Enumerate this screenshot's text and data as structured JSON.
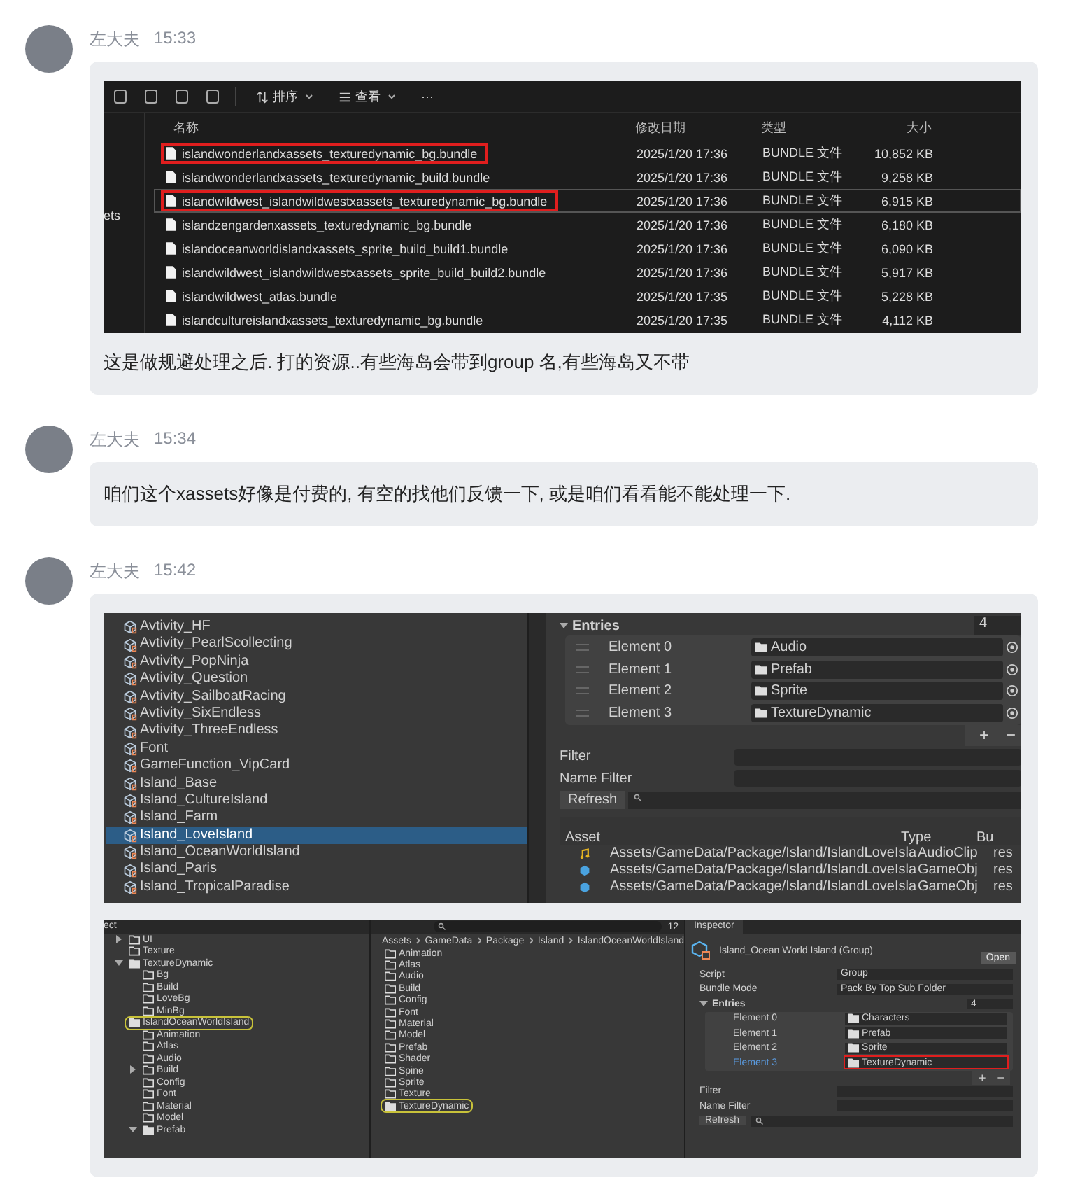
{
  "messages": [
    {
      "sender": "左大夫",
      "time": "15:33",
      "content": [
        {
          "kind": "explorer",
          "sort_label": "排序",
          "view_label": "查看",
          "more": "···",
          "nav_text": "ets",
          "columns": [
            "名称",
            "修改日期",
            "类型",
            "大小"
          ],
          "rows": [
            {
              "name": "islandwonderlandxassets_texturedynamic_bg.bundle",
              "date": "2025/1/20 17:36",
              "type": "BUNDLE 文件",
              "size": "10,852 KB",
              "marked": true,
              "selected": false
            },
            {
              "name": "islandwonderlandxassets_texturedynamic_build.bundle",
              "date": "2025/1/20 17:36",
              "type": "BUNDLE 文件",
              "size": "9,258 KB",
              "marked": false,
              "selected": false
            },
            {
              "name": "islandwildwest_islandwildwestxassets_texturedynamic_bg.bundle",
              "date": "2025/1/20 17:36",
              "type": "BUNDLE 文件",
              "size": "6,915 KB",
              "marked": true,
              "selected": true
            },
            {
              "name": "islandzengardenxassets_texturedynamic_bg.bundle",
              "date": "2025/1/20 17:36",
              "type": "BUNDLE 文件",
              "size": "6,180 KB",
              "marked": false,
              "selected": false
            },
            {
              "name": "islandoceanworldislandxassets_sprite_build_build1.bundle",
              "date": "2025/1/20 17:36",
              "type": "BUNDLE 文件",
              "size": "6,090 KB",
              "marked": false,
              "selected": false
            },
            {
              "name": "islandwildwest_islandwildwestxassets_sprite_build_build2.bundle",
              "date": "2025/1/20 17:36",
              "type": "BUNDLE 文件",
              "size": "5,917 KB",
              "marked": false,
              "selected": false
            },
            {
              "name": "islandwildwest_atlas.bundle",
              "date": "2025/1/20 17:35",
              "type": "BUNDLE 文件",
              "size": "5,228 KB",
              "marked": false,
              "selected": false
            },
            {
              "name": "islandcultureislandxassets_texturedynamic_bg.bundle",
              "date": "2025/1/20 17:35",
              "type": "BUNDLE 文件",
              "size": "4,112 KB",
              "marked": false,
              "selected": false
            }
          ]
        },
        {
          "kind": "text",
          "text": "这是做规避处理之后. 打的资源..有些海岛会带到group 名,有些海岛又不带"
        }
      ]
    },
    {
      "sender": "左大夫",
      "time": "15:34",
      "content": [
        {
          "kind": "text",
          "text": "咱们这个xassets好像是付费的, 有空的找他们反馈一下, 或是咱们看看能不能处理一下."
        }
      ]
    },
    {
      "sender": "左大夫",
      "time": "15:42",
      "content": [
        {
          "kind": "unity_groups",
          "groups": [
            {
              "label": "Avtivity_HF",
              "selected": false
            },
            {
              "label": "Avtivity_PearlScollecting",
              "selected": false
            },
            {
              "label": "Avtivity_PopNinja",
              "selected": false
            },
            {
              "label": "Avtivity_Question",
              "selected": false
            },
            {
              "label": "Avtivity_SailboatRacing",
              "selected": false
            },
            {
              "label": "Avtivity_SixEndless",
              "selected": false
            },
            {
              "label": "Avtivity_ThreeEndless",
              "selected": false
            },
            {
              "label": "Font",
              "selected": false
            },
            {
              "label": "GameFunction_VipCard",
              "selected": false
            },
            {
              "label": "Island_Base",
              "selected": false
            },
            {
              "label": "Island_CultureIsland",
              "selected": false
            },
            {
              "label": "Island_Farm",
              "selected": false
            },
            {
              "label": "Island_LoveIsland",
              "selected": true
            },
            {
              "label": "Island_OceanWorldIsland",
              "selected": false
            },
            {
              "label": "Island_Paris",
              "selected": false
            },
            {
              "label": "Island_TropicalParadise",
              "selected": false
            }
          ],
          "entries_label": "Entries",
          "entries_count": "4",
          "elements": [
            {
              "label": "Element 0",
              "value": "Audio"
            },
            {
              "label": "Element 1",
              "value": "Prefab"
            },
            {
              "label": "Element 2",
              "value": "Sprite"
            },
            {
              "label": "Element 3",
              "value": "TextureDynamic"
            }
          ],
          "add": "+",
          "remove": "−",
          "filter_label": "Filter",
          "name_filter_label": "Name Filter",
          "refresh": "Refresh",
          "columns": [
            "Asset",
            "Type",
            "Bu"
          ],
          "assets": [
            {
              "kind": "audio",
              "path": "Assets/GameData/Package/Island/IslandLoveIsla",
              "type": "AudioClip",
              "bundle": "res"
            },
            {
              "kind": "prefab",
              "path": "Assets/GameData/Package/Island/IslandLoveIsla",
              "type": "GameObj",
              "bundle": "res"
            },
            {
              "kind": "prefab",
              "path": "Assets/GameData/Package/Island/IslandLoveIsla",
              "type": "GameObj",
              "bundle": "res"
            }
          ]
        },
        {
          "kind": "unity_inspector",
          "project_tab": "ect",
          "tree": [
            {
              "name": "UI",
              "expanded": false
            },
            {
              "name": "Texture"
            },
            {
              "name": "TextureDynamic",
              "expanded": true,
              "children": [
                {
                  "name": "Bg"
                },
                {
                  "name": "Build"
                },
                {
                  "name": "LoveBg"
                },
                {
                  "name": "MinBg"
                }
              ]
            },
            {
              "name": "IslandOceanWorldIsland",
              "marked": true,
              "children": [
                {
                  "name": "Animation"
                },
                {
                  "name": "Atlas"
                },
                {
                  "name": "Audio"
                },
                {
                  "name": "Build",
                  "expanded": false
                },
                {
                  "name": "Config"
                },
                {
                  "name": "Font"
                },
                {
                  "name": "Material"
                },
                {
                  "name": "Model"
                },
                {
                  "name": "Prefab",
                  "expanded": true
                }
              ]
            }
          ],
          "search_count": "12",
          "breadcrumb": [
            "Assets",
            "GameData",
            "Package",
            "Island",
            "IslandOceanWorldIsland"
          ],
          "folders": [
            {
              "name": "Animation",
              "marked": false
            },
            {
              "name": "Atlas",
              "marked": false
            },
            {
              "name": "Audio",
              "marked": false
            },
            {
              "name": "Build",
              "marked": false
            },
            {
              "name": "Config",
              "marked": false
            },
            {
              "name": "Font",
              "marked": false
            },
            {
              "name": "Material",
              "marked": false
            },
            {
              "name": "Model",
              "marked": false
            },
            {
              "name": "Prefab",
              "marked": false
            },
            {
              "name": "Shader",
              "marked": false
            },
            {
              "name": "Spine",
              "marked": false
            },
            {
              "name": "Sprite",
              "marked": false
            },
            {
              "name": "Texture",
              "marked": false
            },
            {
              "name": "TextureDynamic",
              "marked": true
            }
          ],
          "inspector_tab": "Inspector",
          "title": "Island_Ocean World Island (Group)",
          "open": "Open",
          "fields": [
            {
              "label": "Script",
              "value": "Group"
            },
            {
              "label": "Bundle Mode",
              "value": "Pack By Top Sub Folder"
            }
          ],
          "entries_label": "Entries",
          "entries_count": "4",
          "elements": [
            {
              "label": "Element 0",
              "value": "Characters",
              "selected": false,
              "marked": false
            },
            {
              "label": "Element 1",
              "value": "Prefab",
              "selected": false,
              "marked": false
            },
            {
              "label": "Element 2",
              "value": "Sprite",
              "selected": false,
              "marked": false
            },
            {
              "label": "Element 3",
              "value": "TextureDynamic",
              "selected": true,
              "marked": true
            }
          ],
          "add": "+",
          "remove": "−",
          "filter_label": "Filter",
          "name_filter_label": "Name Filter",
          "refresh": "Refresh"
        }
      ]
    }
  ]
}
